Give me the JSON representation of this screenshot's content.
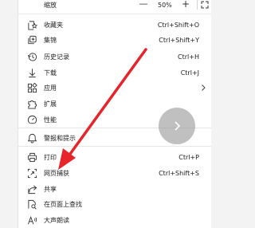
{
  "zoom": {
    "label": "缩放",
    "minus": "—",
    "value": "50%",
    "plus": "+"
  },
  "items": [
    {
      "label": "收藏夹",
      "shortcut": "Ctrl+Shift+O",
      "icon": "favorites-icon"
    },
    {
      "label": "集锦",
      "shortcut": "Ctrl+Shift+Y",
      "icon": "collections-icon"
    },
    {
      "label": "历史记录",
      "shortcut": "Ctrl+H",
      "icon": "history-icon"
    },
    {
      "label": "下载",
      "shortcut": "Ctrl+J",
      "icon": "download-icon"
    },
    {
      "label": "应用",
      "shortcut": "",
      "icon": "apps-icon"
    },
    {
      "label": "扩展",
      "shortcut": "",
      "icon": "extensions-icon"
    },
    {
      "label": "性能",
      "shortcut": "",
      "icon": "performance-icon"
    },
    {
      "label": "警报和提示",
      "shortcut": "",
      "icon": "alerts-icon"
    },
    {
      "label": "打印",
      "shortcut": "Ctrl+P",
      "icon": "print-icon"
    },
    {
      "label": "网页捕获",
      "shortcut": "Ctrl+Shift+S",
      "icon": "web-capture-icon"
    },
    {
      "label": "共享",
      "shortcut": "",
      "icon": "share-icon"
    },
    {
      "label": "在页面上查找",
      "shortcut": "",
      "icon": "find-icon"
    },
    {
      "label": "大声朗读",
      "shortcut": "",
      "icon": "read-aloud-icon"
    }
  ],
  "colors": {
    "arrow": "#e8242b",
    "menu_bg": "#ffffff",
    "text": "#1f1f1f"
  }
}
